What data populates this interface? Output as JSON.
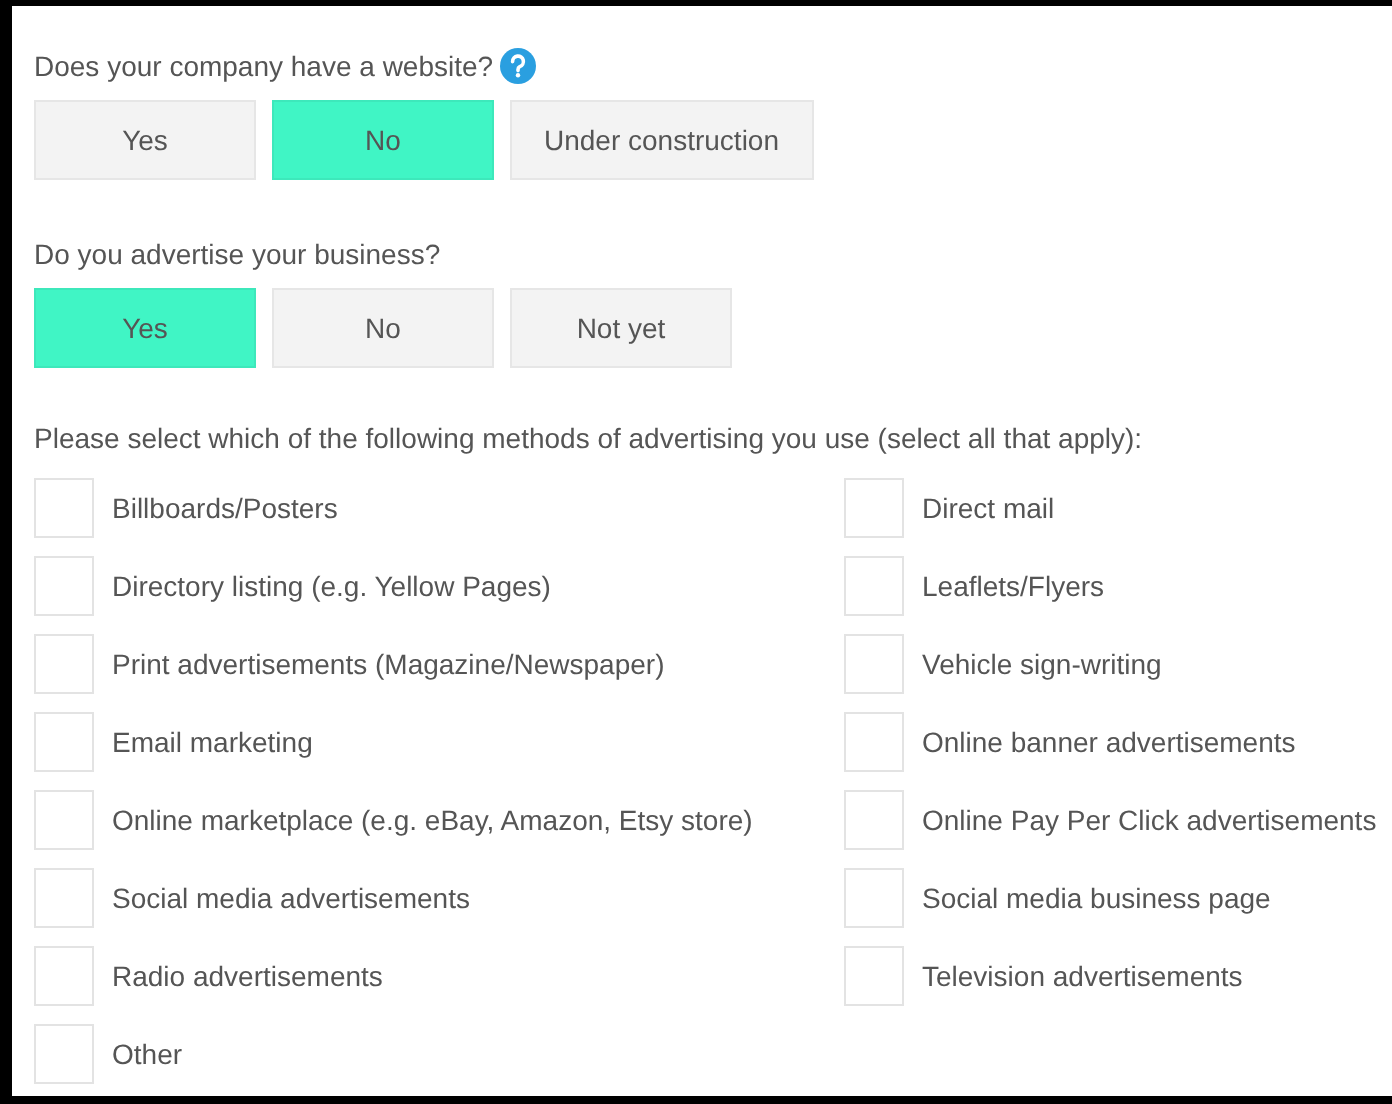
{
  "questions": [
    {
      "label": "Does your company have a website?",
      "help": true,
      "options": [
        {
          "label": "Yes",
          "selected": false
        },
        {
          "label": "No",
          "selected": true
        },
        {
          "label": "Under construction",
          "selected": false
        }
      ]
    },
    {
      "label": "Do you advertise your business?",
      "help": false,
      "options": [
        {
          "label": "Yes",
          "selected": true
        },
        {
          "label": "No",
          "selected": false
        },
        {
          "label": "Not yet",
          "selected": false
        }
      ]
    }
  ],
  "methods": {
    "label": "Please select which of the following methods of advertising you use (select all that apply):",
    "items": [
      {
        "label": "Billboards/Posters",
        "checked": false
      },
      {
        "label": "Direct mail",
        "checked": false
      },
      {
        "label": "Directory listing (e.g. Yellow Pages)",
        "checked": false
      },
      {
        "label": "Leaflets/Flyers",
        "checked": false
      },
      {
        "label": "Print advertisements (Magazine/Newspaper)",
        "checked": false
      },
      {
        "label": "Vehicle sign-writing",
        "checked": false
      },
      {
        "label": "Email marketing",
        "checked": false
      },
      {
        "label": "Online banner advertisements",
        "checked": false
      },
      {
        "label": "Online marketplace (e.g. eBay, Amazon, Etsy store)",
        "checked": false
      },
      {
        "label": "Online Pay Per Click advertisements",
        "checked": false
      },
      {
        "label": "Social media advertisements",
        "checked": false
      },
      {
        "label": "Social media business page",
        "checked": false
      },
      {
        "label": "Radio advertisements",
        "checked": false
      },
      {
        "label": "Television advertisements",
        "checked": false
      },
      {
        "label": "Other",
        "checked": false
      }
    ]
  }
}
